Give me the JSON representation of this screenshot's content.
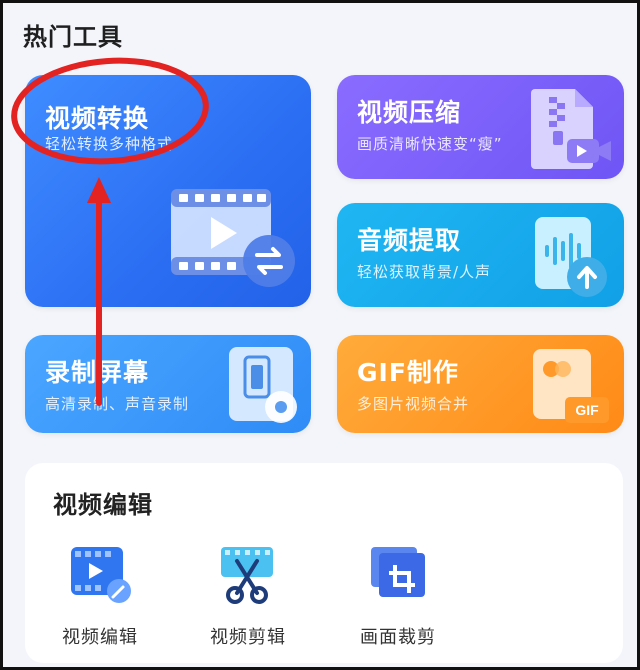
{
  "section_title": "热门工具",
  "cards": {
    "convert": {
      "title": "视频转换",
      "subtitle": "轻松转换多种格式"
    },
    "compress": {
      "title": "视频压缩",
      "subtitle": "画质清晰快速变“瘦”"
    },
    "extract": {
      "title": "音频提取",
      "subtitle": "轻松获取背景/人声"
    },
    "record": {
      "title": "录制屏幕",
      "subtitle": "高清录制、声音录制"
    },
    "gif": {
      "title": "GIF制作",
      "subtitle": "多图片视频合并",
      "badge": "GIF"
    }
  },
  "video_edit": {
    "title": "视频编辑",
    "tools": [
      {
        "label": "视频编辑",
        "icon": "video-edit-icon"
      },
      {
        "label": "视频剪辑",
        "icon": "scissors-film-icon"
      },
      {
        "label": "画面裁剪",
        "icon": "crop-icon"
      }
    ]
  },
  "annotation": {
    "color": "#e32222"
  }
}
